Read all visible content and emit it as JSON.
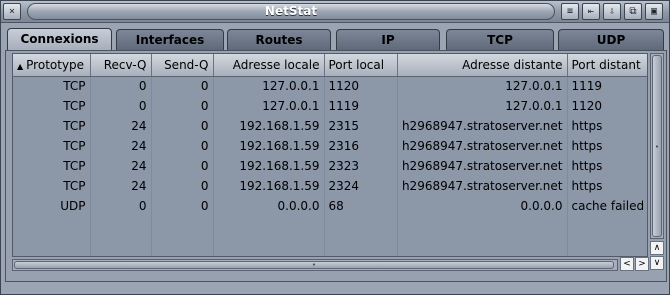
{
  "window": {
    "title": "NetStat",
    "buttons": {
      "close_icon": "×",
      "b1_icon": "≡",
      "b2_icon": "⇤",
      "b3_icon": "⇩",
      "b4_icon": "⧉",
      "b5_icon": "▣"
    }
  },
  "tabs": [
    {
      "label": "Connexions",
      "active": true
    },
    {
      "label": "Interfaces",
      "active": false
    },
    {
      "label": "Routes",
      "active": false
    },
    {
      "label": "IP",
      "active": false
    },
    {
      "label": "TCP",
      "active": false
    },
    {
      "label": "UDP",
      "active": false
    }
  ],
  "table": {
    "columns": [
      "Prototype",
      "Recv-Q",
      "Send-Q",
      "Adresse locale",
      "Port local",
      "Adresse distante",
      "Port distant"
    ],
    "sort_indicator": "▲",
    "rows": [
      [
        "TCP",
        "0",
        "0",
        "127.0.0.1",
        "1120",
        "127.0.0.1",
        "1119"
      ],
      [
        "TCP",
        "0",
        "0",
        "127.0.0.1",
        "1119",
        "127.0.0.1",
        "1120"
      ],
      [
        "TCP",
        "24",
        "0",
        "192.168.1.59",
        "2315",
        "h2968947.stratoserver.net",
        "https"
      ],
      [
        "TCP",
        "24",
        "0",
        "192.168.1.59",
        "2316",
        "h2968947.stratoserver.net",
        "https"
      ],
      [
        "TCP",
        "24",
        "0",
        "192.168.1.59",
        "2323",
        "h2968947.stratoserver.net",
        "https"
      ],
      [
        "TCP",
        "24",
        "0",
        "192.168.1.59",
        "2324",
        "h2968947.stratoserver.net",
        "https"
      ],
      [
        "UDP",
        "0",
        "0",
        "0.0.0.0",
        "68",
        "0.0.0.0",
        "cache failed"
      ]
    ]
  },
  "scroll": {
    "up_icon": "∧",
    "down_icon": "∨",
    "left_icon": "<",
    "right_icon": ">",
    "grip_v": "•",
    "grip_h": "•"
  },
  "colors": {
    "window_bg": "#9aa4b3",
    "table_bg": "#8c97a8",
    "header_bg": "#c4cad3",
    "tab_inactive": "#6e7888",
    "tab_active": "#b8bfca"
  }
}
